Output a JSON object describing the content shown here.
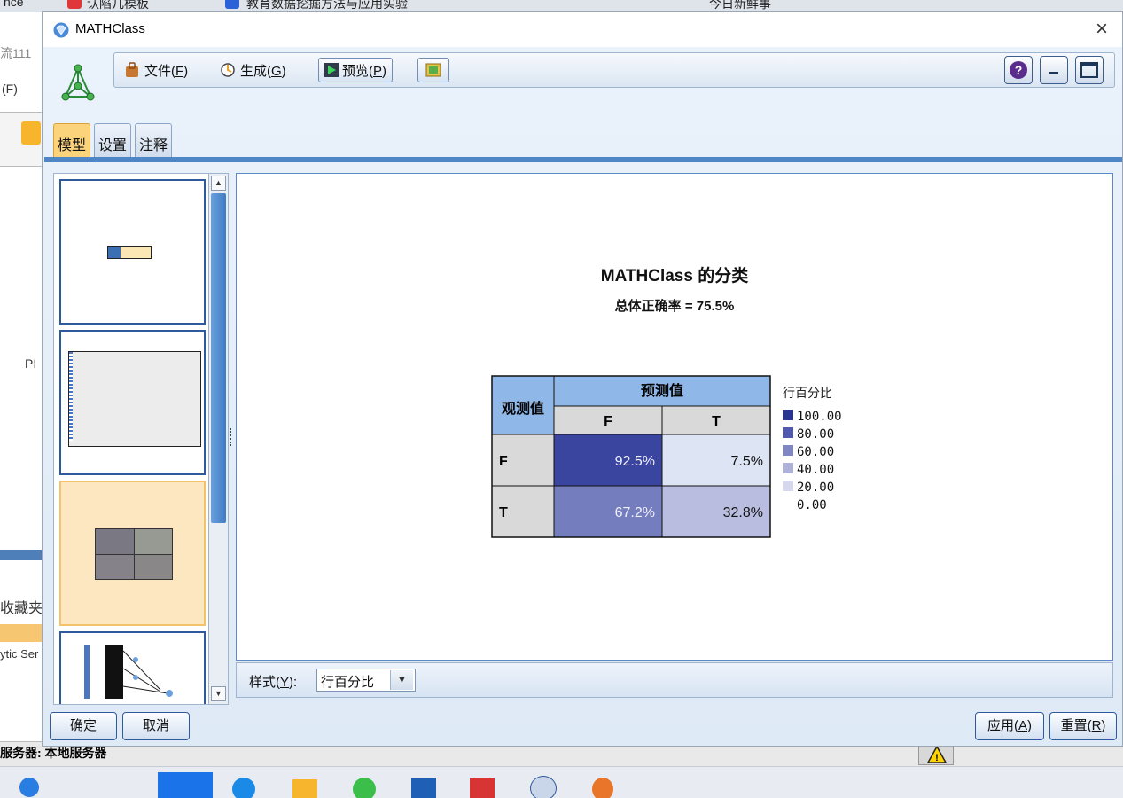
{
  "background": {
    "tabs": [
      "nce",
      "认陷几模板",
      "教育数据挖掘方法与应用实验",
      "今日新鲜事"
    ],
    "left_texts": [
      "流111",
      "(F)",
      "PI",
      "收藏夹",
      "ytic Ser"
    ],
    "status_label": "服务器: 本地服务器"
  },
  "dialog": {
    "title": "MATHClass",
    "toolbar": {
      "file_label": "文件(",
      "file_key": "F",
      "generate_label": "生成(",
      "generate_key": "G",
      "preview_label": "预览(",
      "preview_key": "P",
      "close_paren": ")"
    },
    "tabs": [
      "模型",
      "设置",
      "注释"
    ],
    "active_tab": 0,
    "chart": {
      "title": "MATHClass 的分类",
      "subtitle": "总体正确率 = 75.5%"
    },
    "style": {
      "label_prefix": "样式(",
      "label_key": "Y",
      "label_suffix": "):",
      "value": "行百分比"
    },
    "buttons": {
      "ok": "确定",
      "cancel": "取消",
      "apply_prefix": "应用(",
      "apply_key": "A",
      "reset_prefix": "重置(",
      "reset_key": "R",
      "paren": ")"
    }
  },
  "chart_data": {
    "type": "table",
    "row_header": "观测值",
    "column_header": "预测值",
    "columns": [
      "F",
      "T"
    ],
    "rows": [
      {
        "label": "F",
        "values": [
          "92.5%",
          "7.5%"
        ],
        "numeric": [
          92.5,
          7.5
        ]
      },
      {
        "label": "T",
        "values": [
          "67.2%",
          "32.8%"
        ],
        "numeric": [
          67.2,
          32.8
        ]
      }
    ],
    "legend": {
      "title": "行百分比",
      "entries": [
        "100.00",
        "80.00",
        "60.00",
        "40.00",
        "20.00",
        "0.00"
      ],
      "colors": [
        "#2a3592",
        "#5059ad",
        "#7f86c1",
        "#aeb2d8",
        "#d5d8ec",
        "#ffffff"
      ]
    },
    "cell_colors": [
      [
        "#3a45a0",
        "#dde4f3"
      ],
      [
        "#747dbd",
        "#b9bde0"
      ]
    ]
  }
}
